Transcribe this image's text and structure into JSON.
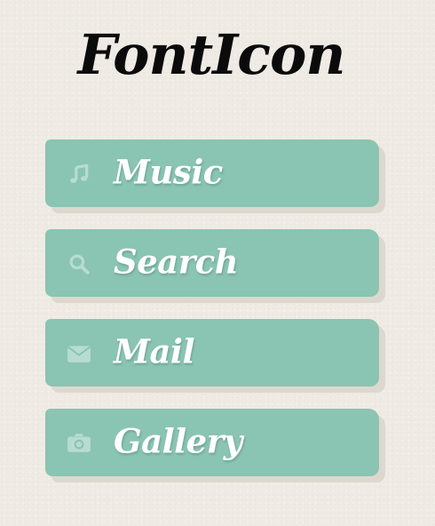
{
  "app": {
    "title": "FontIcon"
  },
  "colors": {
    "background": "#efebe4",
    "button": "#8ac4b2",
    "button_shadow": "#ddd8cf",
    "icon": "#b7dcd0",
    "label": "#ffffff",
    "title": "#0b0b0b"
  },
  "menu": {
    "items": [
      {
        "label": "Music",
        "icon": "music-note-icon"
      },
      {
        "label": "Search",
        "icon": "search-icon"
      },
      {
        "label": "Mail",
        "icon": "envelope-icon"
      },
      {
        "label": "Gallery",
        "icon": "camera-icon"
      }
    ]
  }
}
